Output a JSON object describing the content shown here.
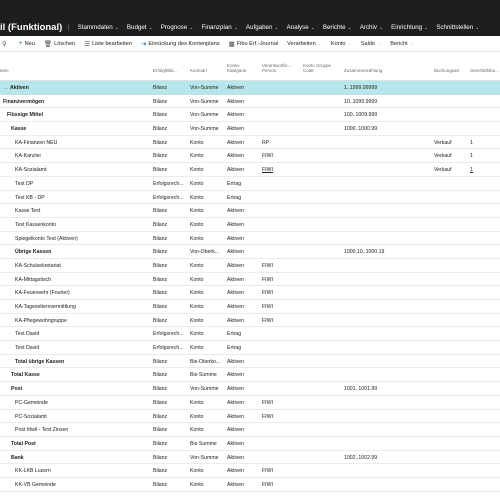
{
  "page_title": "il (Funktional)",
  "nav": [
    {
      "label": "Stammdaten"
    },
    {
      "label": "Budget"
    },
    {
      "label": "Prognose"
    },
    {
      "label": "Finanzplan"
    },
    {
      "label": "Aufgaben"
    },
    {
      "label": "Analyse"
    },
    {
      "label": "Berichte"
    },
    {
      "label": "Archiv"
    },
    {
      "label": "Einrichtung"
    },
    {
      "label": "Schnittstellen"
    }
  ],
  "toolbar": {
    "new": "Neu",
    "delete": "Löschen",
    "edit_list": "Liste bearbeiten",
    "indent": "Einrückung des Kontenplans",
    "fibu": "Fibu Erf.-Journal",
    "verarbeiten": "Verarbeiten",
    "konto": "Konto",
    "saldo": "Saldo",
    "bericht": "Bericht"
  },
  "columns": {
    "name": "ame",
    "erfolg": "Erfolg/Bila...",
    "kontoart": "Kontoart",
    "kategorie": "Konto-\nKategorie",
    "person": "Verantwortlic...\nPerson",
    "gruppe": "Konto Gruppe\nCode",
    "zusammen": "Zusammenzählung",
    "buchungsart": "Buchungsart",
    "geschaeft": "Geschäftsbu..."
  },
  "rows": [
    {
      "name": "Aktiven",
      "indent": 10,
      "bold": true,
      "selected": true,
      "arrow": true,
      "erfolg": "Bilanz",
      "kontoart": "Von-Summe",
      "kategorie": "Aktiven",
      "person": "",
      "gruppe": "",
      "zusammen": "1..1999.99999",
      "buchungsart": "",
      "geschaeft": ""
    },
    {
      "name": "Finanzvermögen",
      "indent": 3,
      "bold": true,
      "erfolg": "Bilanz",
      "kontoart": "Von-Summe",
      "kategorie": "Aktiven",
      "person": "",
      "gruppe": "",
      "zusammen": "10..1099.9999",
      "buchungsart": "",
      "geschaeft": ""
    },
    {
      "name": "Flüssige Mittel",
      "indent": 7,
      "bold": true,
      "erfolg": "Bilanz",
      "kontoart": "Von-Summe",
      "kategorie": "Aktiven",
      "person": "",
      "gruppe": "",
      "zusammen": "100..1009.999",
      "buchungsart": "",
      "geschaeft": ""
    },
    {
      "name": "Kasse",
      "indent": 11,
      "bold": true,
      "erfolg": "Bilanz",
      "kontoart": "Von-Summe",
      "kategorie": "Aktiven",
      "person": "",
      "gruppe": "",
      "zusammen": "1000..1000.99",
      "buchungsart": "",
      "geschaeft": ""
    },
    {
      "name": "KA-Finanzen NEU",
      "indent": 15,
      "bold": false,
      "erfolg": "Bilanz",
      "kontoart": "Konto",
      "kategorie": "Aktiven",
      "person": "RP",
      "gruppe": "",
      "zusammen": "",
      "buchungsart": "Verkauf",
      "geschaeft": "1"
    },
    {
      "name": "KA-Kanzlei",
      "indent": 15,
      "bold": false,
      "erfolg": "Bilanz",
      "kontoart": "Konto",
      "kategorie": "Aktiven",
      "person": "FIWI",
      "gruppe": "",
      "zusammen": "",
      "buchungsart": "Verkauf",
      "geschaeft": "1"
    },
    {
      "name": "KA-Sozialamt",
      "indent": 15,
      "bold": false,
      "erfolg": "Bilanz",
      "kontoart": "Konto",
      "kategorie": "Aktiven",
      "person": "FIWI",
      "person_u": true,
      "gruppe": "",
      "zusammen": "",
      "buchungsart": "Verkauf",
      "geschaeft": "1",
      "geschaeft_u": true
    },
    {
      "name": "Test DP",
      "indent": 15,
      "bold": false,
      "erfolg": "Erfolgsrech...",
      "kontoart": "Konto",
      "kategorie": "Ertrag",
      "person": "",
      "gruppe": "",
      "zusammen": "",
      "buchungsart": "",
      "geschaeft": ""
    },
    {
      "name": "Test KB - DP",
      "indent": 15,
      "bold": false,
      "erfolg": "Erfolgsrech...",
      "kontoart": "Konto",
      "kategorie": "Ertrag",
      "person": "",
      "gruppe": "",
      "zusammen": "",
      "buchungsart": "",
      "geschaeft": ""
    },
    {
      "name": "Kasse Test",
      "indent": 15,
      "bold": false,
      "erfolg": "Bilanz",
      "kontoart": "Konto",
      "kategorie": "Aktiven",
      "person": "",
      "gruppe": "",
      "zusammen": "",
      "buchungsart": "",
      "geschaeft": ""
    },
    {
      "name": "Test Kassenkonto",
      "indent": 15,
      "bold": false,
      "erfolg": "Bilanz",
      "kontoart": "Konto",
      "kategorie": "Aktiven",
      "person": "",
      "gruppe": "",
      "zusammen": "",
      "buchungsart": "",
      "geschaeft": ""
    },
    {
      "name": "Spiegelkonto Test (Aktiven)",
      "indent": 15,
      "bold": false,
      "erfolg": "Bilanz",
      "kontoart": "Konto",
      "kategorie": "Aktiven",
      "person": "",
      "gruppe": "",
      "zusammen": "",
      "buchungsart": "",
      "geschaeft": ""
    },
    {
      "name": "Übrige Kassen",
      "indent": 15,
      "bold": true,
      "erfolg": "Bilanz",
      "kontoart": "Von-Oberk...",
      "kategorie": "Aktiven",
      "person": "",
      "gruppe": "",
      "zusammen": "1000.10..1000.19",
      "buchungsart": "",
      "geschaeft": ""
    },
    {
      "name": "KA-Schulsekretariat",
      "indent": 15,
      "bold": false,
      "erfolg": "Bilanz",
      "kontoart": "Konto",
      "kategorie": "Aktiven",
      "person": "FIWI",
      "gruppe": "",
      "zusammen": "",
      "buchungsart": "",
      "geschaeft": ""
    },
    {
      "name": "KA-Mittagstisch",
      "indent": 15,
      "bold": false,
      "erfolg": "Bilanz",
      "kontoart": "Konto",
      "kategorie": "Aktiven",
      "person": "FIWI",
      "gruppe": "",
      "zusammen": "",
      "buchungsart": "",
      "geschaeft": ""
    },
    {
      "name": "KA-Feuerwehr (Fourier)",
      "indent": 15,
      "bold": false,
      "erfolg": "Bilanz",
      "kontoart": "Konto",
      "kategorie": "Aktiven",
      "person": "FIWI",
      "gruppe": "",
      "zusammen": "",
      "buchungsart": "",
      "geschaeft": ""
    },
    {
      "name": "KA-Tageselternvermittlung",
      "indent": 15,
      "bold": false,
      "erfolg": "Bilanz",
      "kontoart": "Konto",
      "kategorie": "Aktiven",
      "person": "FIWI",
      "gruppe": "",
      "zusammen": "",
      "buchungsart": "",
      "geschaeft": ""
    },
    {
      "name": "KA-Pflegewohngruppe",
      "indent": 15,
      "bold": false,
      "erfolg": "Bilanz",
      "kontoart": "Konto",
      "kategorie": "Aktiven",
      "person": "FIWI",
      "gruppe": "",
      "zusammen": "",
      "buchungsart": "",
      "geschaeft": ""
    },
    {
      "name": "Test David",
      "indent": 15,
      "bold": false,
      "erfolg": "Erfolgsrech...",
      "kontoart": "Konto",
      "kategorie": "Ertrag",
      "person": "",
      "gruppe": "",
      "zusammen": "",
      "buchungsart": "",
      "geschaeft": ""
    },
    {
      "name": "Test David",
      "indent": 15,
      "bold": false,
      "erfolg": "Erfolgsrech...",
      "kontoart": "Konto",
      "kategorie": "Ertrag",
      "person": "",
      "gruppe": "",
      "zusammen": "",
      "buchungsart": "",
      "geschaeft": ""
    },
    {
      "name": "Total übrige Kassen",
      "indent": 15,
      "bold": true,
      "erfolg": "Bilanz",
      "kontoart": "Bis-Oberko...",
      "kategorie": "Aktiven",
      "person": "",
      "gruppe": "",
      "zusammen": "",
      "buchungsart": "",
      "geschaeft": ""
    },
    {
      "name": "Total Kasse",
      "indent": 11,
      "bold": true,
      "erfolg": "Bilanz",
      "kontoart": "Bis-Summe",
      "kategorie": "Aktiven",
      "person": "",
      "gruppe": "",
      "zusammen": "",
      "buchungsart": "",
      "geschaeft": ""
    },
    {
      "name": "Post",
      "indent": 11,
      "bold": true,
      "erfolg": "Bilanz",
      "kontoart": "Von-Summe",
      "kategorie": "Aktiven",
      "person": "",
      "gruppe": "",
      "zusammen": "1001..1001.99",
      "buchungsart": "",
      "geschaeft": ""
    },
    {
      "name": "PC-Gemeinde",
      "indent": 15,
      "bold": false,
      "erfolg": "Bilanz",
      "kontoart": "Konto",
      "kategorie": "Aktiven",
      "person": "FIWI",
      "gruppe": "",
      "zusammen": "",
      "buchungsart": "",
      "geschaeft": ""
    },
    {
      "name": "PC-Sozialamt",
      "indent": 15,
      "bold": false,
      "erfolg": "Bilanz",
      "kontoart": "Konto",
      "kategorie": "Aktiven",
      "person": "FIWI",
      "gruppe": "",
      "zusammen": "",
      "buchungsart": "",
      "geschaeft": ""
    },
    {
      "name": "Post Ittwil - Test Zinsen",
      "indent": 15,
      "bold": false,
      "erfolg": "Bilanz",
      "kontoart": "Konto",
      "kategorie": "Aktiven",
      "person": "",
      "gruppe": "",
      "zusammen": "",
      "buchungsart": "",
      "geschaeft": ""
    },
    {
      "name": "Total Post",
      "indent": 11,
      "bold": true,
      "erfolg": "Bilanz",
      "kontoart": "Bis-Summe",
      "kategorie": "Aktiven",
      "person": "",
      "gruppe": "",
      "zusammen": "",
      "buchungsart": "",
      "geschaeft": ""
    },
    {
      "name": "Bank",
      "indent": 11,
      "bold": true,
      "erfolg": "Bilanz",
      "kontoart": "Von-Summe",
      "kategorie": "Aktiven",
      "person": "",
      "gruppe": "",
      "zusammen": "1002..1002.99",
      "buchungsart": "",
      "geschaeft": ""
    },
    {
      "name": "KK-LKB Luzern",
      "indent": 15,
      "bold": false,
      "erfolg": "Bilanz",
      "kontoart": "Konto",
      "kategorie": "Aktiven",
      "person": "FIWI",
      "gruppe": "",
      "zusammen": "",
      "buchungsart": "",
      "geschaeft": ""
    },
    {
      "name": "KK-VB Gemeinde",
      "indent": 15,
      "bold": false,
      "erfolg": "Bilanz",
      "kontoart": "Konto",
      "kategorie": "Aktiven",
      "person": "FIWI",
      "gruppe": "",
      "zusammen": "",
      "buchungsart": "",
      "geschaeft": ""
    }
  ],
  "colors": {
    "topbar": "#1e1e1e",
    "selected_row": "#b7e6ea",
    "accent": "#0f6cbd"
  }
}
